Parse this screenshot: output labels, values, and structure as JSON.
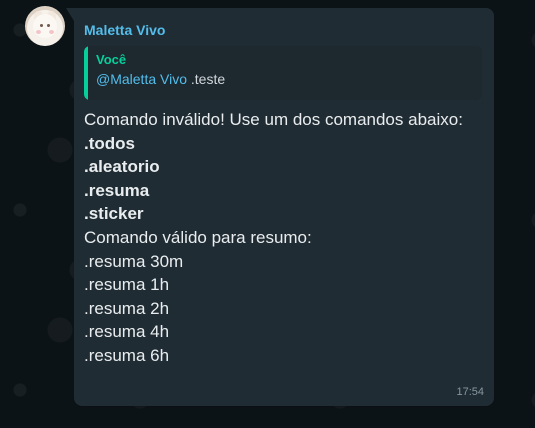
{
  "message": {
    "sender": "Maletta Vivo",
    "quote": {
      "author": "Você",
      "mention": "@Maletta Vivo",
      "text": " .teste"
    },
    "lines": {
      "line1": "Comando inválido! Use um dos comandos abaixo:",
      "line2": ".todos",
      "line3": ".aleatorio",
      "line4": ".resuma",
      "line5": ".sticker",
      "line6": "",
      "line7": "Comando válido para resumo:",
      "line8": ".resuma 30m",
      "line9": ".resuma 1h",
      "line10": ".resuma 2h",
      "line11": ".resuma 4h",
      "line12": ".resuma 6h"
    },
    "time": "17:54"
  },
  "theme": {
    "background": "#0c1317",
    "bubble": "#202c33",
    "accent_sender": "#53bdeb",
    "accent_quote": "#06cf9c",
    "text": "#e9edef",
    "muted": "#8696a0"
  },
  "icons": {
    "avatar": "cat-avatar"
  }
}
